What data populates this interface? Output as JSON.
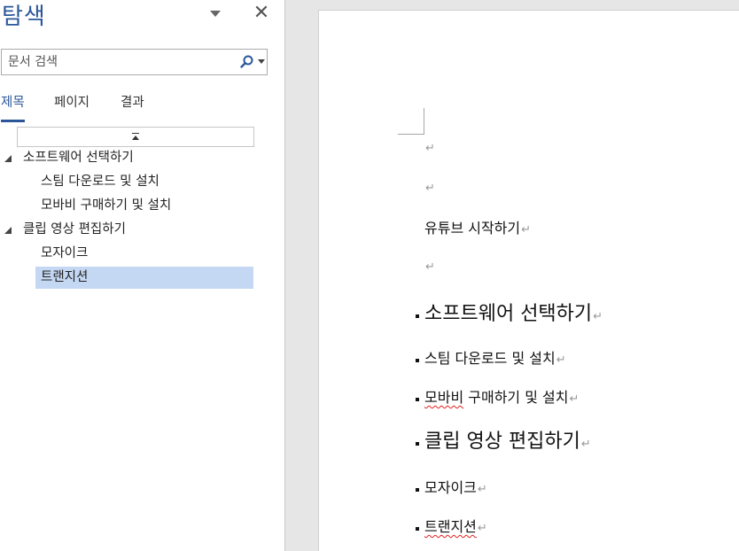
{
  "nav_pane": {
    "title": "탐색",
    "search": {
      "placeholder": "문서 검색",
      "value": ""
    },
    "tabs": [
      {
        "label": "제목",
        "active": true
      },
      {
        "label": "페이지",
        "active": false
      },
      {
        "label": "결과",
        "active": false
      }
    ],
    "headings": [
      {
        "label": "소프트웨어 선택하기",
        "level": 1,
        "expanded": true,
        "selected": false
      },
      {
        "label": "스팀 다운로드 및 설치",
        "level": 2,
        "selected": false
      },
      {
        "label": "모바비 구매하기 및 설치",
        "level": 2,
        "selected": false
      },
      {
        "label": "클립 영상 편집하기",
        "level": 1,
        "expanded": true,
        "selected": false
      },
      {
        "label": "모자이크",
        "level": 2,
        "selected": false
      },
      {
        "label": "트랜지션",
        "level": 2,
        "selected": true
      }
    ]
  },
  "document": {
    "paragraph_mark": "↵",
    "paragraphs": [
      {
        "text": "",
        "style": "body",
        "bullet": false
      },
      {
        "text": "",
        "style": "body",
        "bullet": false
      },
      {
        "text": "유튜브 시작하기",
        "style": "body",
        "bullet": false
      },
      {
        "text": "",
        "style": "body",
        "bullet": false
      },
      {
        "text": "소프트웨어 선택하기",
        "style": "heading1",
        "bullet": true
      },
      {
        "text": "스팀 다운로드 및 설치",
        "style": "heading2",
        "bullet": true
      },
      {
        "text_spellcheck": "모바비",
        "text": " 구매하기 및 설치",
        "style": "heading2",
        "bullet": true
      },
      {
        "text": "클립 영상 편집하기",
        "style": "heading1",
        "bullet": true
      },
      {
        "text": "모자이크",
        "style": "heading2",
        "bullet": true
      },
      {
        "text_spellcheck": "트랜지션",
        "text": "",
        "style": "heading2",
        "bullet": true
      }
    ]
  },
  "colors": {
    "accent": "#2b579a",
    "selection": "#c5d8f3",
    "spellcheck": "#e02020",
    "pane_bg": "#ffffff",
    "app_bg": "#e6e6e6"
  },
  "icons": {
    "menu": "triangle-down-icon",
    "close": "close-icon",
    "search": "magnifier-icon",
    "collapse": "collapse-all-icon",
    "expander": "expanded-triangle-icon"
  }
}
